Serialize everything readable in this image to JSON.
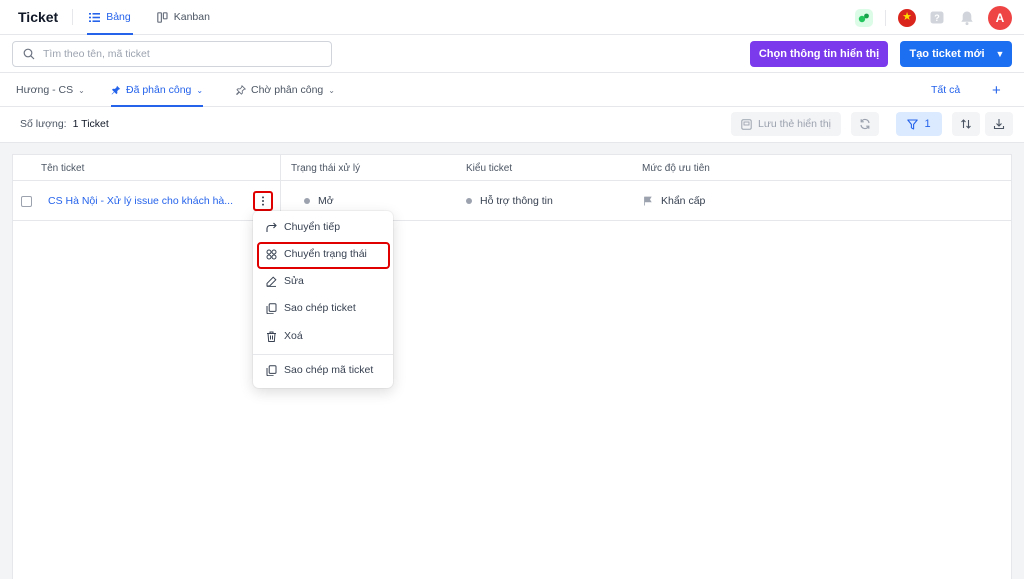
{
  "app": {
    "title": "Ticket"
  },
  "view_tabs": [
    {
      "label": "Bảng",
      "icon": "list-icon",
      "active": true
    },
    {
      "label": "Kanban",
      "icon": "kanban-icon",
      "active": false
    }
  ],
  "header_right": {
    "avatar_letter": "A",
    "flag": "vietnam-flag-icon",
    "accent": "#ef4444"
  },
  "search": {
    "placeholder": "Tìm theo tên, mã ticket",
    "value": ""
  },
  "buttons": {
    "choose_display": "Chọn thông tin hiển thị",
    "new_ticket": "Tạo ticket mới"
  },
  "filter_tabs": [
    {
      "label": "Hương - CS",
      "active": false
    },
    {
      "label": "Đã phân công",
      "active": true
    },
    {
      "label": "Chờ phân công",
      "active": false
    }
  ],
  "filter_all": "Tất cả",
  "count": {
    "label": "Số lượng:",
    "value": "1 Ticket"
  },
  "toolbar": {
    "save_view": "Lưu thẻ hiển thị",
    "filter_count": "1"
  },
  "table": {
    "headers": [
      "Tên ticket",
      "Trạng thái xử lý",
      "Kiểu ticket",
      "Mức độ ưu tiên"
    ],
    "rows": [
      {
        "name": "CS Hà Nội - Xử lý issue cho khách hà...",
        "status": "Mở",
        "type": "Hỗ trợ thông tin",
        "priority": "Khẩn cấp"
      }
    ]
  },
  "context_menu": {
    "items": [
      "Chuyển tiếp",
      "Chuyển trạng thái",
      "Sửa",
      "Sao chép ticket",
      "Xoá",
      "Sao chép mã ticket"
    ],
    "highlighted": "Chuyển trạng thái"
  },
  "colors": {
    "primary": "#2563eb",
    "purple": "#7c3aed",
    "highlight": "#e00000"
  }
}
